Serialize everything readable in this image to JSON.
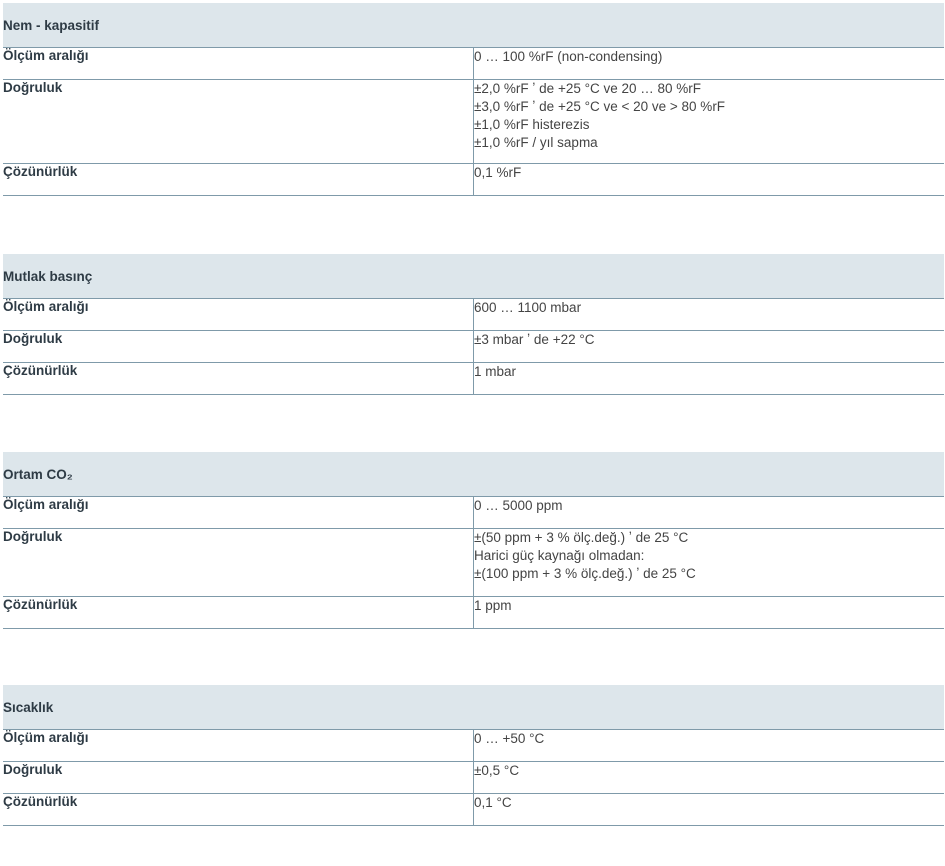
{
  "sections": [
    {
      "title": "Nem - kapasitif",
      "rows": [
        {
          "label": "Ölçüm aralığı",
          "lines": [
            "0 … 100 %rF (non-condensing)"
          ]
        },
        {
          "label": "Doğruluk",
          "lines": [
            "±2,0 %rF ʼ de +25 °C ve 20 … 80 %rF",
            "±3,0 %rF ʼ de +25 °C ve < 20 ve > 80 %rF",
            "±1,0 %rF histerezis",
            "±1,0 %rF / yıl sapma"
          ]
        },
        {
          "label": "Çözünürlük",
          "lines": [
            "0,1 %rF"
          ]
        }
      ]
    },
    {
      "title": "Mutlak basınç",
      "rows": [
        {
          "label": "Ölçüm aralığı",
          "lines": [
            "600 … 1100 mbar"
          ]
        },
        {
          "label": "Doğruluk",
          "lines": [
            "±3 mbar ʼ de +22 °C"
          ]
        },
        {
          "label": "Çözünürlük",
          "lines": [
            "1 mbar"
          ]
        }
      ]
    },
    {
      "title": "Ortam CO₂",
      "rows": [
        {
          "label": "Ölçüm aralığı",
          "lines": [
            "0 … 5000 ppm"
          ]
        },
        {
          "label": "Doğruluk",
          "lines": [
            "±(50 ppm + 3 % ölç.değ.) ʼ de 25 °C",
            "Harici güç kaynağı olmadan:",
            "±(100 ppm + 3 % ölç.değ.) ʼ de 25 °C"
          ]
        },
        {
          "label": "Çözünürlük",
          "lines": [
            "1 ppm"
          ]
        }
      ]
    },
    {
      "title": "Sıcaklık",
      "rows": [
        {
          "label": "Ölçüm aralığı",
          "lines": [
            "0 … +50 °C"
          ]
        },
        {
          "label": "Doğruluk",
          "lines": [
            "±0,5 °C"
          ]
        },
        {
          "label": "Çözünürlük",
          "lines": [
            "0,1 °C"
          ]
        }
      ]
    }
  ]
}
